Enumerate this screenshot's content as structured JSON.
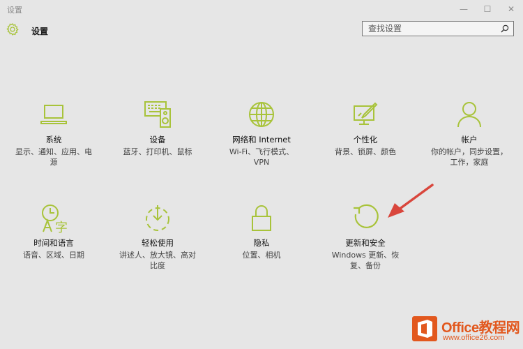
{
  "window": {
    "title": "设置",
    "minimize": "—",
    "maximize": "☐",
    "close": "✕"
  },
  "header": {
    "title": "设置",
    "icon": "gear-icon"
  },
  "search": {
    "placeholder": "查找设置",
    "icon": "search-icon"
  },
  "accent_color": "#a8c33a",
  "categories": [
    {
      "id": "system",
      "name": "系统",
      "desc": "显示、通知、应用、电源",
      "icon": "laptop-icon"
    },
    {
      "id": "devices",
      "name": "设备",
      "desc": "蓝牙、打印机、鼠标",
      "icon": "devices-icon"
    },
    {
      "id": "network",
      "name": "网络和 Internet",
      "desc": "Wi-Fi、飞行模式、VPN",
      "icon": "globe-icon"
    },
    {
      "id": "personalization",
      "name": "个性化",
      "desc": "背景、锁屏、颜色",
      "icon": "paint-icon"
    },
    {
      "id": "accounts",
      "name": "帐户",
      "desc": "你的帐户，同步设置，工作，家庭",
      "icon": "person-icon"
    },
    {
      "id": "time-language",
      "name": "时间和语言",
      "desc": "语音、区域、日期",
      "icon": "time-language-icon"
    },
    {
      "id": "ease-of-access",
      "name": "轻松使用",
      "desc": "讲述人、放大镜、高对比度",
      "icon": "ease-of-access-icon"
    },
    {
      "id": "privacy",
      "name": "隐私",
      "desc": "位置、相机",
      "icon": "lock-icon"
    },
    {
      "id": "update-security",
      "name": "更新和安全",
      "desc": "Windows 更新、恢复、备份",
      "icon": "refresh-icon"
    }
  ],
  "watermark": {
    "brand": "Office教程网",
    "url": "www.office26.com"
  }
}
